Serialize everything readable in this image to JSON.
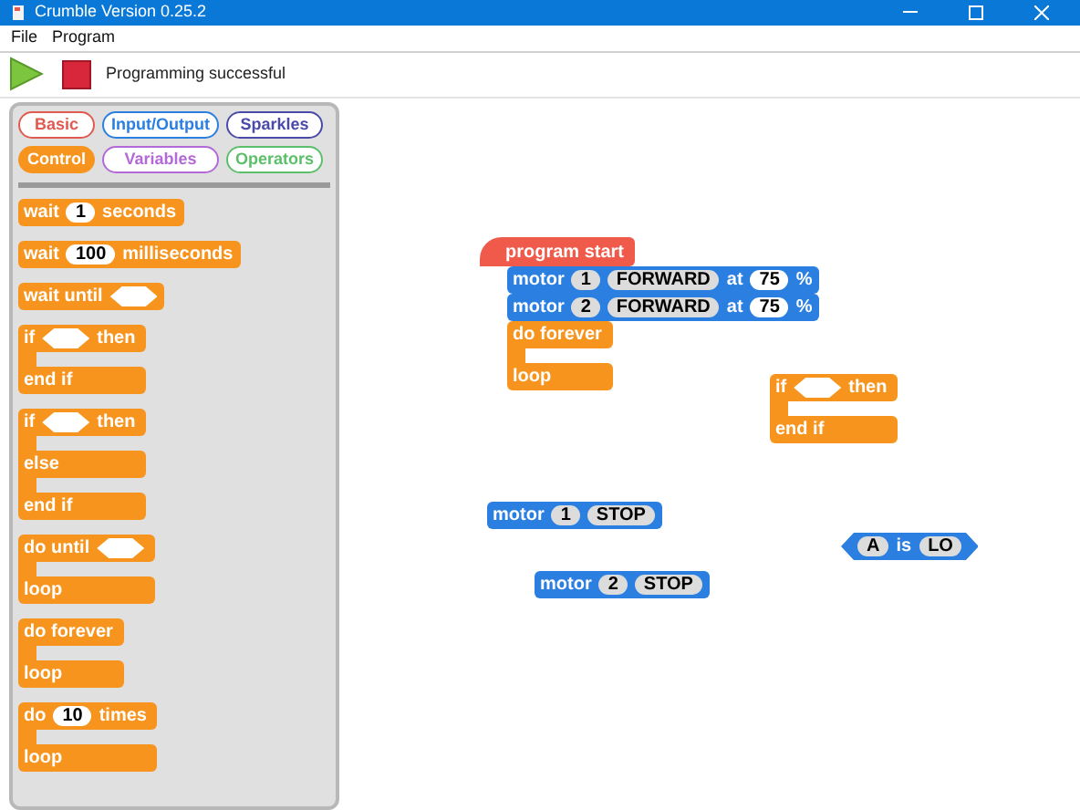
{
  "window": {
    "title": "Crumble Version 0.25.2"
  },
  "menu": [
    "File",
    "Program"
  ],
  "toolbar": {
    "status": "Programming successful"
  },
  "palette": {
    "tabs": [
      {
        "label": "Basic",
        "color": "#e05a4f",
        "selected": false
      },
      {
        "label": "Input/Output",
        "color": "#2a7fe0",
        "selected": false
      },
      {
        "label": "Sparkles",
        "color": "#4a4aa8",
        "selected": false
      },
      {
        "label": "Control",
        "color": "#f7941d",
        "selected": true
      },
      {
        "label": "Variables",
        "color": "#b36ad6",
        "selected": false
      },
      {
        "label": "Operators",
        "color": "#5cbf6a",
        "selected": false
      }
    ],
    "blocks": [
      {
        "kind": "command",
        "color": "#f7941d",
        "arms": [
          [
            {
              "kind": "text",
              "text": "wait"
            },
            {
              "kind": "number",
              "text": "1"
            },
            {
              "kind": "text",
              "text": "seconds"
            }
          ]
        ]
      },
      {
        "kind": "command",
        "color": "#f7941d",
        "arms": [
          [
            {
              "kind": "text",
              "text": "wait"
            },
            {
              "kind": "number",
              "text": "100"
            },
            {
              "kind": "text",
              "text": "milliseconds"
            }
          ]
        ]
      },
      {
        "kind": "command",
        "color": "#f7941d",
        "arms": [
          [
            {
              "kind": "text",
              "text": "wait until"
            },
            {
              "kind": "hex"
            }
          ]
        ]
      },
      {
        "kind": "c",
        "color": "#f7941d",
        "arms": [
          [
            {
              "kind": "text",
              "text": "if"
            },
            {
              "kind": "hex"
            },
            {
              "kind": "text",
              "text": "then"
            }
          ],
          [
            {
              "kind": "text",
              "text": "end if"
            }
          ]
        ]
      },
      {
        "kind": "c",
        "color": "#f7941d",
        "arms": [
          [
            {
              "kind": "text",
              "text": "if"
            },
            {
              "kind": "hex"
            },
            {
              "kind": "text",
              "text": "then"
            }
          ],
          [
            {
              "kind": "text",
              "text": "else"
            }
          ],
          [
            {
              "kind": "text",
              "text": "end if"
            }
          ]
        ]
      },
      {
        "kind": "c",
        "color": "#f7941d",
        "arms": [
          [
            {
              "kind": "text",
              "text": "do until"
            },
            {
              "kind": "hex"
            }
          ],
          [
            {
              "kind": "text",
              "text": "loop"
            }
          ]
        ]
      },
      {
        "kind": "c",
        "color": "#f7941d",
        "arms": [
          [
            {
              "kind": "text",
              "text": "do forever"
            }
          ],
          [
            {
              "kind": "text",
              "text": "loop"
            }
          ]
        ]
      },
      {
        "kind": "c",
        "color": "#f7941d",
        "arms": [
          [
            {
              "kind": "text",
              "text": "do"
            },
            {
              "kind": "number",
              "text": "10"
            },
            {
              "kind": "text",
              "text": "times"
            }
          ],
          [
            {
              "kind": "text",
              "text": "loop"
            }
          ]
        ]
      }
    ]
  },
  "canvas": {
    "scripts": [
      {
        "blocks": [
          {
            "kind": "hat",
            "color": "#f05a4a",
            "arms": [
              [
                {
                  "kind": "text",
                  "text": "program start"
                }
              ]
            ]
          },
          {
            "kind": "command",
            "color": "#2a7fe0",
            "arms": [
              [
                {
                  "kind": "text",
                  "text": "motor"
                },
                {
                  "kind": "pill",
                  "text": "1"
                },
                {
                  "kind": "pill",
                  "text": "FORWARD"
                },
                {
                  "kind": "text",
                  "text": "at"
                },
                {
                  "kind": "number",
                  "text": "75"
                },
                {
                  "kind": "text",
                  "text": "%"
                }
              ]
            ]
          },
          {
            "kind": "command",
            "color": "#2a7fe0",
            "arms": [
              [
                {
                  "kind": "text",
                  "text": "motor"
                },
                {
                  "kind": "pill",
                  "text": "2"
                },
                {
                  "kind": "pill",
                  "text": "FORWARD"
                },
                {
                  "kind": "text",
                  "text": "at"
                },
                {
                  "kind": "number",
                  "text": "75"
                },
                {
                  "kind": "text",
                  "text": "%"
                }
              ]
            ]
          },
          {
            "kind": "c",
            "color": "#f7941d",
            "arms": [
              [
                {
                  "kind": "text",
                  "text": "do forever"
                }
              ],
              [
                {
                  "kind": "text",
                  "text": "loop"
                }
              ]
            ]
          }
        ]
      },
      {
        "blocks": [
          {
            "kind": "c",
            "color": "#f7941d",
            "arms": [
              [
                {
                  "kind": "text",
                  "text": "if"
                },
                {
                  "kind": "hex"
                },
                {
                  "kind": "text",
                  "text": "then"
                }
              ],
              [
                {
                  "kind": "text",
                  "text": "end if"
                }
              ]
            ]
          }
        ]
      },
      {
        "blocks": [
          {
            "kind": "command",
            "color": "#2a7fe0",
            "arms": [
              [
                {
                  "kind": "text",
                  "text": "motor"
                },
                {
                  "kind": "pill",
                  "text": "1"
                },
                {
                  "kind": "pill",
                  "text": "STOP"
                }
              ]
            ]
          }
        ]
      },
      {
        "blocks": [
          {
            "kind": "boolean",
            "color": "#2a7fe0",
            "arms": [
              [
                {
                  "kind": "pill",
                  "text": "A"
                },
                {
                  "kind": "text",
                  "text": "is"
                },
                {
                  "kind": "pill",
                  "text": "LO"
                }
              ]
            ]
          }
        ]
      },
      {
        "blocks": [
          {
            "kind": "command",
            "color": "#2a7fe0",
            "arms": [
              [
                {
                  "kind": "text",
                  "text": "motor"
                },
                {
                  "kind": "pill",
                  "text": "2"
                },
                {
                  "kind": "pill",
                  "text": "STOP"
                }
              ]
            ]
          }
        ]
      }
    ]
  }
}
